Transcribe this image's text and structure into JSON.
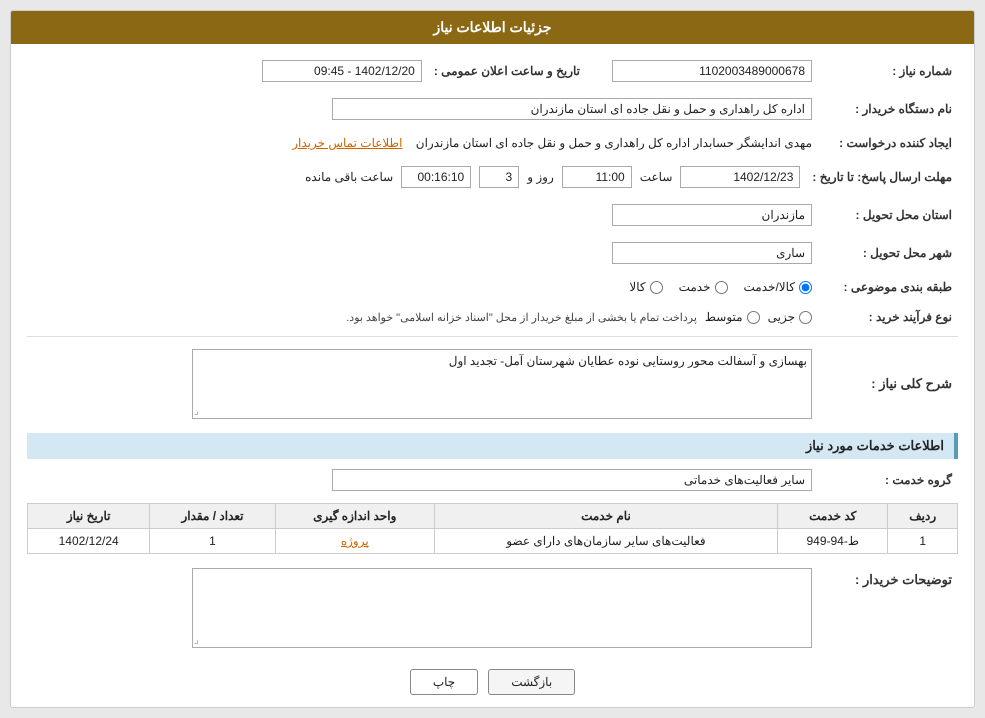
{
  "header": {
    "title": "جزئیات اطلاعات نیاز"
  },
  "fields": {
    "need_number_label": "شماره نیاز :",
    "need_number_value": "1102003489000678",
    "announcement_datetime_label": "تاریخ و ساعت اعلان عمومی :",
    "announcement_datetime_value": "1402/12/20 - 09:45",
    "buyer_org_label": "نام دستگاه خریدار :",
    "buyer_org_value": "اداره کل راهداری و حمل و نقل جاده ای استان مازندران",
    "creator_label": "ایجاد کننده درخواست :",
    "creator_value": "مهدی اندایشگر حسابدار اداره کل راهداری و حمل و نقل جاده ای استان مازندران",
    "contact_link": "اطلاعات تماس خریدار",
    "response_deadline_label": "مهلت ارسال پاسخ: تا تاریخ :",
    "response_date": "1402/12/23",
    "response_time_label": "ساعت",
    "response_time": "11:00",
    "response_days_label": "روز و",
    "response_days": "3",
    "response_remaining_label": "ساعت باقی مانده",
    "response_remaining": "00:16:10",
    "delivery_province_label": "استان محل تحویل :",
    "delivery_province_value": "مازندران",
    "delivery_city_label": "شهر محل تحویل :",
    "delivery_city_value": "ساری",
    "category_label": "طبقه بندی موضوعی :",
    "category_options": [
      "کالا",
      "خدمت",
      "کالا/خدمت"
    ],
    "category_selected": "کالا/خدمت",
    "purchase_type_label": "نوع فرآیند خرید :",
    "purchase_type_options": [
      "جزیی",
      "متوسط"
    ],
    "purchase_type_note": "پرداخت تمام یا بخشی از مبلغ خریدار از محل \"اسناد خزانه اسلامی\" خواهد بود.",
    "need_description_label": "شرح کلی نیاز :",
    "need_description_value": "بهسازی و آسفالت محور روستایی نوده عطایان شهرستان آمل- تجدید اول",
    "services_section_title": "اطلاعات خدمات مورد نیاز",
    "service_group_label": "گروه خدمت :",
    "service_group_value": "سایر فعالیت‌های خدماتی",
    "table": {
      "columns": [
        "ردیف",
        "کد خدمت",
        "نام خدمت",
        "واحد اندازه گیری",
        "تعداد / مقدار",
        "تاریخ نیاز"
      ],
      "rows": [
        {
          "row": "1",
          "code": "ط-94-949",
          "name": "فعالیت‌های سایر سازمان‌های دارای عضو",
          "unit": "پروژه",
          "quantity": "1",
          "date": "1402/12/24"
        }
      ]
    },
    "buyer_notes_label": "توضیحات خریدار :",
    "buyer_notes_value": "",
    "btn_print": "چاپ",
    "btn_back": "بازگشت"
  }
}
